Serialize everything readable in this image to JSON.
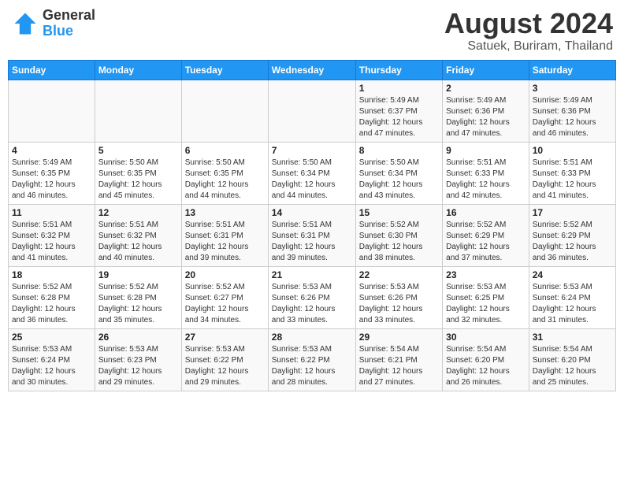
{
  "header": {
    "logo_general": "General",
    "logo_blue": "Blue",
    "month_title": "August 2024",
    "location": "Satuek, Buriram, Thailand"
  },
  "days_of_week": [
    "Sunday",
    "Monday",
    "Tuesday",
    "Wednesday",
    "Thursday",
    "Friday",
    "Saturday"
  ],
  "weeks": [
    [
      {
        "day": "",
        "info": ""
      },
      {
        "day": "",
        "info": ""
      },
      {
        "day": "",
        "info": ""
      },
      {
        "day": "",
        "info": ""
      },
      {
        "day": "1",
        "info": "Sunrise: 5:49 AM\nSunset: 6:37 PM\nDaylight: 12 hours\nand 47 minutes."
      },
      {
        "day": "2",
        "info": "Sunrise: 5:49 AM\nSunset: 6:36 PM\nDaylight: 12 hours\nand 47 minutes."
      },
      {
        "day": "3",
        "info": "Sunrise: 5:49 AM\nSunset: 6:36 PM\nDaylight: 12 hours\nand 46 minutes."
      }
    ],
    [
      {
        "day": "4",
        "info": "Sunrise: 5:49 AM\nSunset: 6:35 PM\nDaylight: 12 hours\nand 46 minutes."
      },
      {
        "day": "5",
        "info": "Sunrise: 5:50 AM\nSunset: 6:35 PM\nDaylight: 12 hours\nand 45 minutes."
      },
      {
        "day": "6",
        "info": "Sunrise: 5:50 AM\nSunset: 6:35 PM\nDaylight: 12 hours\nand 44 minutes."
      },
      {
        "day": "7",
        "info": "Sunrise: 5:50 AM\nSunset: 6:34 PM\nDaylight: 12 hours\nand 44 minutes."
      },
      {
        "day": "8",
        "info": "Sunrise: 5:50 AM\nSunset: 6:34 PM\nDaylight: 12 hours\nand 43 minutes."
      },
      {
        "day": "9",
        "info": "Sunrise: 5:51 AM\nSunset: 6:33 PM\nDaylight: 12 hours\nand 42 minutes."
      },
      {
        "day": "10",
        "info": "Sunrise: 5:51 AM\nSunset: 6:33 PM\nDaylight: 12 hours\nand 41 minutes."
      }
    ],
    [
      {
        "day": "11",
        "info": "Sunrise: 5:51 AM\nSunset: 6:32 PM\nDaylight: 12 hours\nand 41 minutes."
      },
      {
        "day": "12",
        "info": "Sunrise: 5:51 AM\nSunset: 6:32 PM\nDaylight: 12 hours\nand 40 minutes."
      },
      {
        "day": "13",
        "info": "Sunrise: 5:51 AM\nSunset: 6:31 PM\nDaylight: 12 hours\nand 39 minutes."
      },
      {
        "day": "14",
        "info": "Sunrise: 5:51 AM\nSunset: 6:31 PM\nDaylight: 12 hours\nand 39 minutes."
      },
      {
        "day": "15",
        "info": "Sunrise: 5:52 AM\nSunset: 6:30 PM\nDaylight: 12 hours\nand 38 minutes."
      },
      {
        "day": "16",
        "info": "Sunrise: 5:52 AM\nSunset: 6:29 PM\nDaylight: 12 hours\nand 37 minutes."
      },
      {
        "day": "17",
        "info": "Sunrise: 5:52 AM\nSunset: 6:29 PM\nDaylight: 12 hours\nand 36 minutes."
      }
    ],
    [
      {
        "day": "18",
        "info": "Sunrise: 5:52 AM\nSunset: 6:28 PM\nDaylight: 12 hours\nand 36 minutes."
      },
      {
        "day": "19",
        "info": "Sunrise: 5:52 AM\nSunset: 6:28 PM\nDaylight: 12 hours\nand 35 minutes."
      },
      {
        "day": "20",
        "info": "Sunrise: 5:52 AM\nSunset: 6:27 PM\nDaylight: 12 hours\nand 34 minutes."
      },
      {
        "day": "21",
        "info": "Sunrise: 5:53 AM\nSunset: 6:26 PM\nDaylight: 12 hours\nand 33 minutes."
      },
      {
        "day": "22",
        "info": "Sunrise: 5:53 AM\nSunset: 6:26 PM\nDaylight: 12 hours\nand 33 minutes."
      },
      {
        "day": "23",
        "info": "Sunrise: 5:53 AM\nSunset: 6:25 PM\nDaylight: 12 hours\nand 32 minutes."
      },
      {
        "day": "24",
        "info": "Sunrise: 5:53 AM\nSunset: 6:24 PM\nDaylight: 12 hours\nand 31 minutes."
      }
    ],
    [
      {
        "day": "25",
        "info": "Sunrise: 5:53 AM\nSunset: 6:24 PM\nDaylight: 12 hours\nand 30 minutes."
      },
      {
        "day": "26",
        "info": "Sunrise: 5:53 AM\nSunset: 6:23 PM\nDaylight: 12 hours\nand 29 minutes."
      },
      {
        "day": "27",
        "info": "Sunrise: 5:53 AM\nSunset: 6:22 PM\nDaylight: 12 hours\nand 29 minutes."
      },
      {
        "day": "28",
        "info": "Sunrise: 5:53 AM\nSunset: 6:22 PM\nDaylight: 12 hours\nand 28 minutes."
      },
      {
        "day": "29",
        "info": "Sunrise: 5:54 AM\nSunset: 6:21 PM\nDaylight: 12 hours\nand 27 minutes."
      },
      {
        "day": "30",
        "info": "Sunrise: 5:54 AM\nSunset: 6:20 PM\nDaylight: 12 hours\nand 26 minutes."
      },
      {
        "day": "31",
        "info": "Sunrise: 5:54 AM\nSunset: 6:20 PM\nDaylight: 12 hours\nand 25 minutes."
      }
    ]
  ]
}
